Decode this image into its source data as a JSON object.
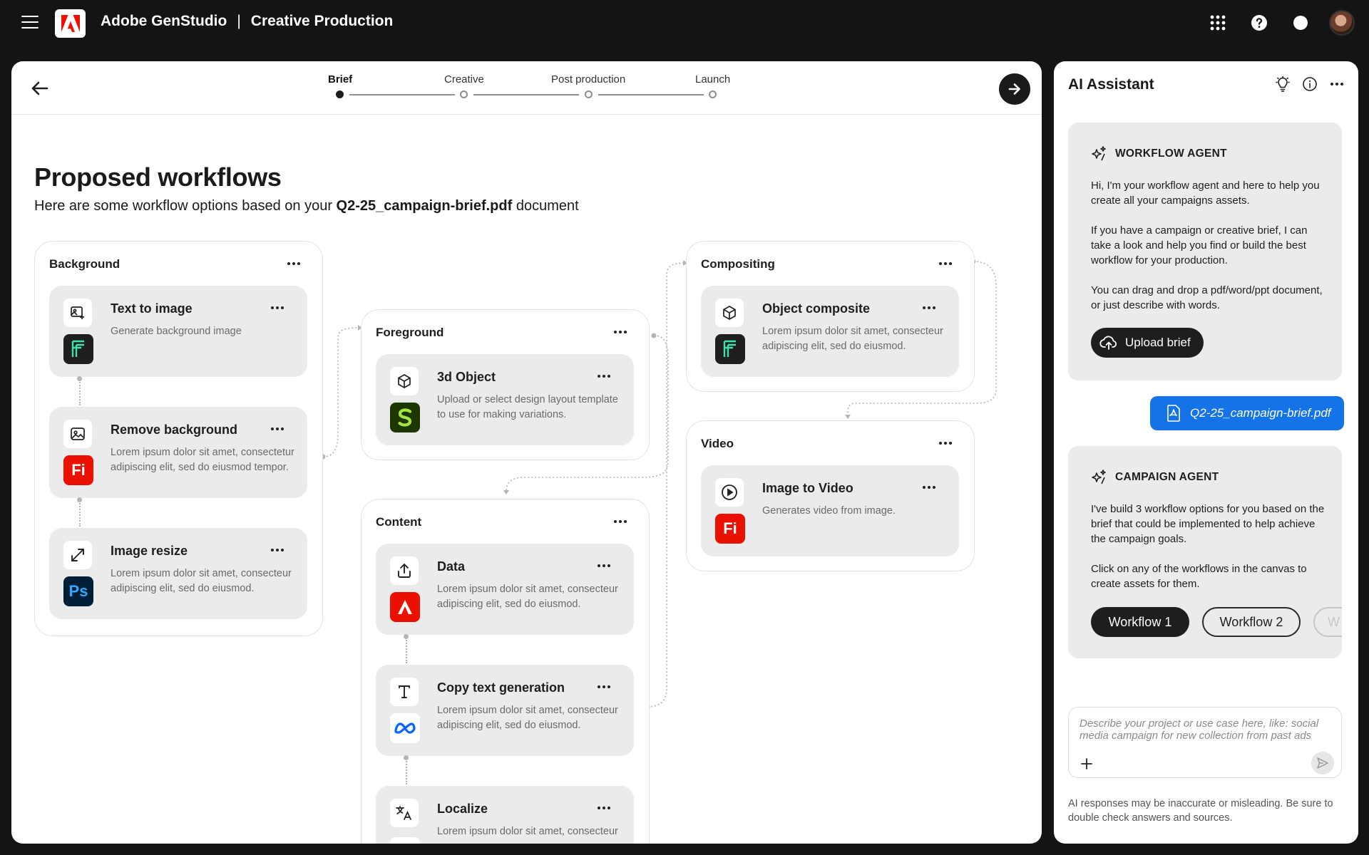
{
  "header": {
    "app_name": "Adobe GenStudio",
    "separator": "|",
    "section": "Creative Production",
    "icons": [
      "menu-icon",
      "adobe-logo",
      "apps-grid-icon",
      "help-icon",
      "notification-icon",
      "avatar"
    ]
  },
  "stepper": {
    "steps": [
      "Brief",
      "Creative",
      "Post production",
      "Launch"
    ],
    "active_index": 0
  },
  "page": {
    "title": "Proposed workflows",
    "subtitle_prefix": "Here are some workflow options based on your ",
    "subtitle_file": "Q2-25_campaign-brief.pdf",
    "subtitle_suffix": " document"
  },
  "groups": {
    "background": {
      "title": "Background",
      "cards": [
        {
          "title": "Text to image",
          "desc": "Generate background image",
          "icon": "text-to-image-icon",
          "app": "firefly"
        },
        {
          "title": "Remove background",
          "desc": "Lorem ipsum dolor sit amet, consectetur adipiscing elit, sed do eiusmod tempor.",
          "icon": "remove-background-icon",
          "app": "Fi"
        },
        {
          "title": "Image resize",
          "desc": "Lorem ipsum dolor sit amet, consecteur adipiscing elit, sed do eiusmod.",
          "icon": "resize-icon",
          "app": "Ps"
        }
      ]
    },
    "foreground": {
      "title": "Foreground",
      "cards": [
        {
          "title": "3d Object",
          "desc": "Upload or select design layout template to use for making variations.",
          "icon": "cube-icon",
          "app": "substance"
        }
      ]
    },
    "content": {
      "title": "Content",
      "cards": [
        {
          "title": "Data",
          "desc": "Lorem ipsum dolor sit amet, consecteur adipiscing elit, sed do eiusmod.",
          "icon": "upload-icon",
          "app": "acrobat"
        },
        {
          "title": "Copy text generation",
          "desc": "Lorem ipsum dolor sit amet, consecteur adipiscing elit, sed do eiusmod.",
          "icon": "text-icon",
          "app": "meta"
        },
        {
          "title": "Localize",
          "desc": "Lorem ipsum dolor sit amet, consecteur",
          "icon": "translate-icon",
          "app": "globe"
        }
      ]
    },
    "compositing": {
      "title": "Compositing",
      "cards": [
        {
          "title": "Object composite",
          "desc": "Lorem ipsum dolor sit amet, consecteur adipiscing elit, sed do eiusmod.",
          "icon": "cube-icon",
          "app": "firefly"
        }
      ]
    },
    "video": {
      "title": "Video",
      "cards": [
        {
          "title": "Image to Video",
          "desc": "Generates video from image.",
          "icon": "play-icon",
          "app": "Fi"
        }
      ]
    }
  },
  "assistant": {
    "title": "AI Assistant",
    "workflow_agent": {
      "label": "WORKFLOW AGENT",
      "p1": "Hi, I'm your workflow agent and here to help you create all your campaigns assets.",
      "p2": "If you have a campaign or creative brief, I can take a look and help you find or build the best workflow for your production.",
      "p3": "You can drag and drop a pdf/word/ppt document, or just describe with words.",
      "upload_label": "Upload brief"
    },
    "file_attachment": "Q2-25_campaign-brief.pdf",
    "campaign_agent": {
      "label": "CAMPAIGN AGENT",
      "p1": "I've build 3 workflow options for you based on the brief that could be implemented to help achieve the campaign goals.",
      "p2": "Click on any of the workflows in the canvas to create assets for them.",
      "workflows": [
        "Workflow 1",
        "Workflow 2",
        "W"
      ]
    },
    "input_placeholder": "Describe your project or use case here, like: social media campaign for new collection from past ads",
    "disclaimer": "AI responses may be inaccurate or misleading. Be sure to double check answers and sources."
  },
  "colors": {
    "app_bar": "#141414",
    "accent_blue": "#1473e6",
    "adobe_red": "#eb1000",
    "firefly_bg": "#1f1f1f",
    "firefly_fg": "#3ee2a8",
    "photoshop_bg": "#001e36",
    "photoshop_fg": "#31a8ff",
    "substance_bg": "#1d3700",
    "substance_fg": "#a7e33f"
  }
}
